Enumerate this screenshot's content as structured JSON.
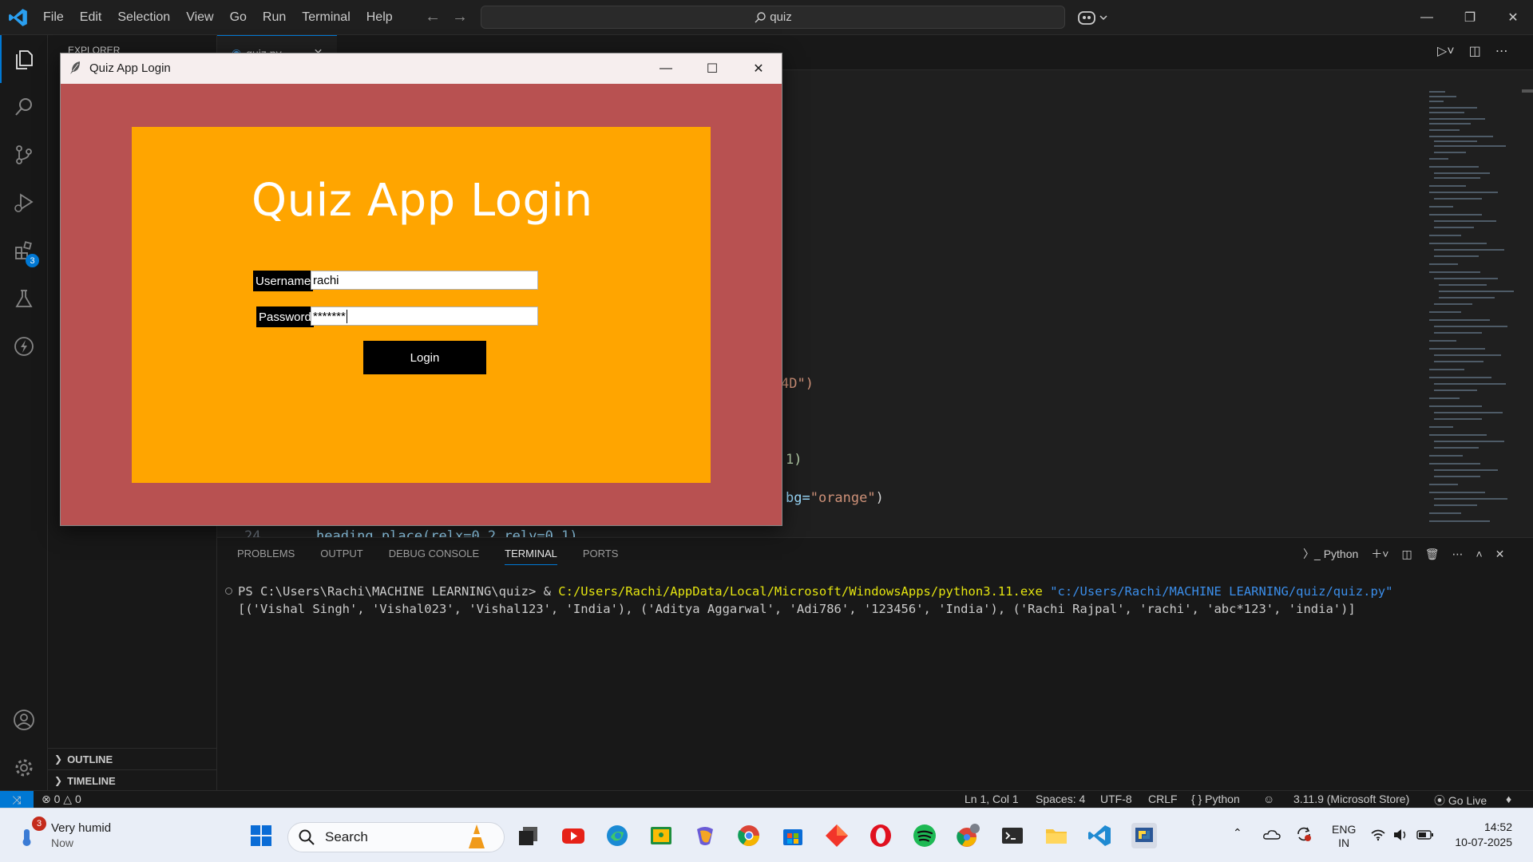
{
  "vscode": {
    "menu": [
      "File",
      "Edit",
      "Selection",
      "View",
      "Go",
      "Run",
      "Terminal",
      "Help"
    ],
    "search_text": "quiz",
    "sidebar_header": "EXPLORER",
    "tab_label": "quiz.py",
    "extensions_badge": "3",
    "sections": {
      "outline": "OUTLINE",
      "timeline": "TIMELINE"
    },
    "code": {
      "frag1": "4D\")",
      "frag2": "1)",
      "frag3_prefix": "bg=",
      "frag3_string": "\"orange\"",
      "frag3_suffix": ")",
      "line_number": "24",
      "line_text": "heading.place(relx=0.2,rely=0.1)"
    },
    "panel": {
      "tabs": [
        "PROBLEMS",
        "OUTPUT",
        "DEBUG CONSOLE",
        "TERMINAL",
        "PORTS"
      ],
      "active_tab": "TERMINAL",
      "shell_name": "Python"
    },
    "terminal": {
      "prompt": "PS C:\\Users\\Rachi\\MACHINE LEARNING\\quiz> & ",
      "exe": "C:/Users/Rachi/AppData/Local/Microsoft/WindowsApps/python3.11.exe",
      "script": "\"c:/Users/Rachi/MACHINE LEARNING/quiz/quiz.py\"",
      "output": "[('Vishal Singh', 'Vishal023', 'Vishal123', 'India'), ('Aditya Aggarwal', 'Adi786', '123456', 'India'), ('Rachi Rajpal', 'rachi', 'abc*123', 'india')]"
    },
    "status": {
      "errors": "0",
      "warnings": "0",
      "position": "Ln 1, Col 1",
      "spaces": "Spaces: 4",
      "encoding": "UTF-8",
      "eol": "CRLF",
      "language": "Python",
      "interpreter": "3.11.9 (Microsoft Store)",
      "go_live": "Go Live"
    }
  },
  "tk": {
    "title": "Quiz App Login",
    "heading": "Quiz App Login",
    "username_label": "Username",
    "username_value": "rachi",
    "password_label": "Password",
    "password_value": "*******",
    "login_button": "Login",
    "colors": {
      "window_bg": "#b85151",
      "frame_bg": "#ffa500",
      "label_bg": "#000000"
    }
  },
  "taskbar": {
    "weather_title": "Very humid",
    "weather_sub": "Now",
    "weather_badge": "3",
    "search_placeholder": "Search",
    "lang_top": "ENG",
    "lang_bottom": "IN",
    "time": "14:52",
    "date": "10-07-2025"
  },
  "colors": {
    "accent": "#0078d4",
    "editor_bg": "#1f1f1f",
    "panel_bg": "#181818",
    "taskbar_bg": "#e9eef7"
  }
}
